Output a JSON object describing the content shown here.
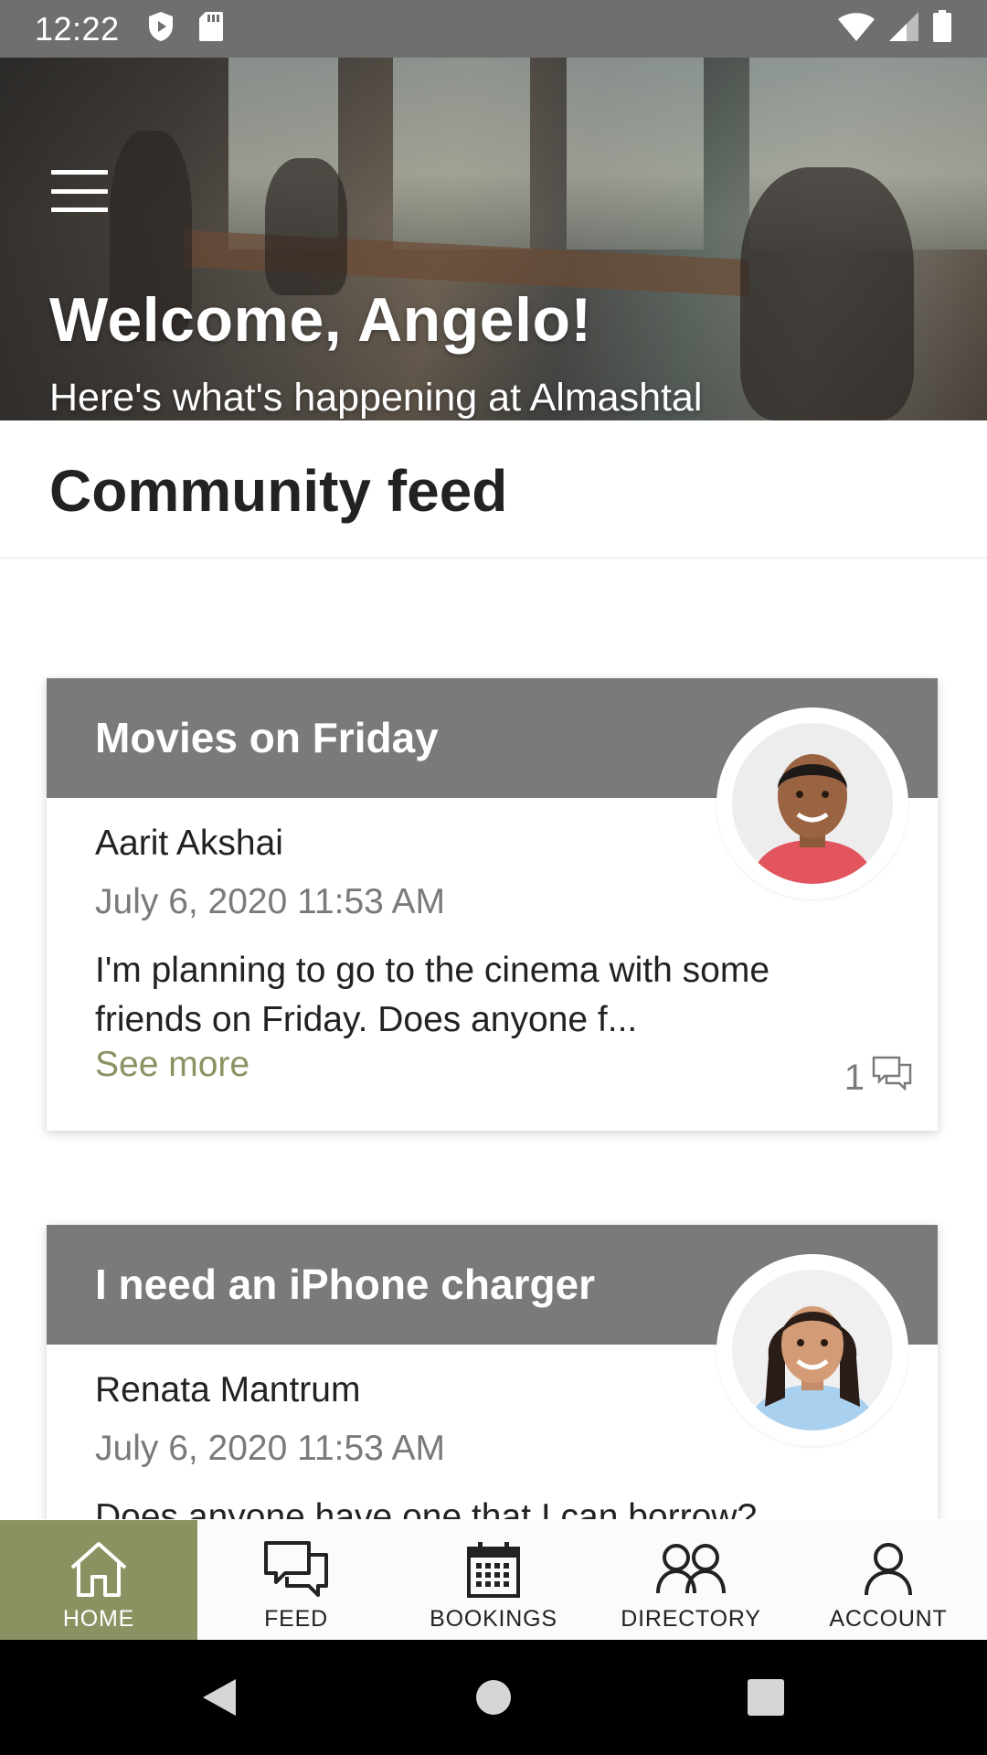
{
  "status_bar": {
    "time": "12:22",
    "icons_left": [
      "shield-play-icon",
      "sd-card-icon"
    ],
    "icons_right": [
      "wifi-icon",
      "signal-icon",
      "battery-icon"
    ]
  },
  "hero": {
    "menu_icon": "hamburger-menu-icon",
    "title": "Welcome, Angelo!",
    "subtitle": "Here's what's happening at Almashtal"
  },
  "section": {
    "title": "Community feed"
  },
  "posts": [
    {
      "title": "Movies on Friday",
      "author": "Aarit Akshai",
      "date": "July 6, 2020 11:53 AM",
      "excerpt": "I'm planning to go to the cinema with some friends on Friday. Does anyone f...",
      "see_more": "See more",
      "comment_count": "1"
    },
    {
      "title": "I need an iPhone charger",
      "author": "Renata Mantrum",
      "date": "July 6, 2020 11:53 AM",
      "excerpt": "Does anyone have one that I can borrow?",
      "see_more": "",
      "comment_count": ""
    }
  ],
  "bottom_nav": [
    {
      "label": "HOME",
      "icon": "home-icon",
      "active": true
    },
    {
      "label": "FEED",
      "icon": "chat-bubbles-icon",
      "active": false
    },
    {
      "label": "BOOKINGS",
      "icon": "calendar-icon",
      "active": false
    },
    {
      "label": "DIRECTORY",
      "icon": "people-icon",
      "active": false
    },
    {
      "label": "ACCOUNT",
      "icon": "person-icon",
      "active": false
    }
  ],
  "colors": {
    "accent": "#8a9262",
    "card_header": "#7a7a7a",
    "status_bar": "#6f6f6f"
  }
}
